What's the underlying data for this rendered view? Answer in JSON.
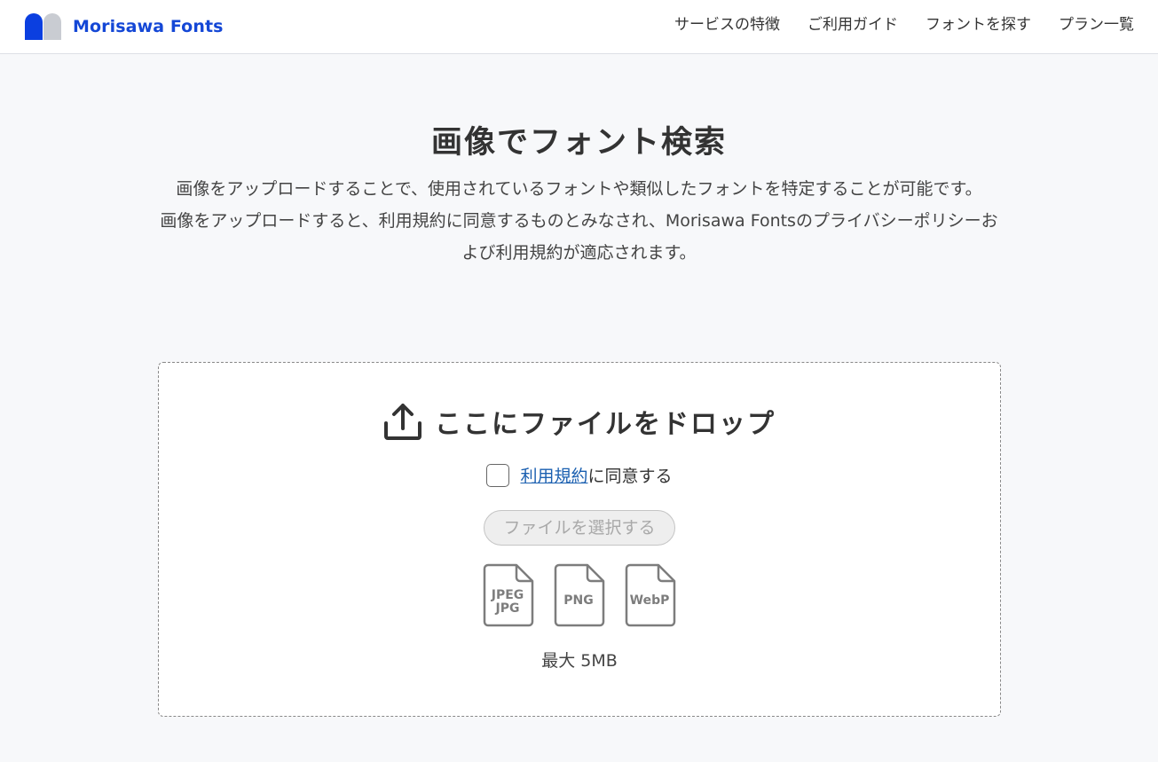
{
  "header": {
    "logo_text": "Morisawa Fonts",
    "brand_color": "#1447d6",
    "nav": [
      {
        "label": "サービスの特徴"
      },
      {
        "label": "ご利用ガイド"
      },
      {
        "label": "フォントを探す"
      },
      {
        "label": "プラン一覧"
      }
    ]
  },
  "main": {
    "title": "画像でフォント検索",
    "desc1": "画像をアップロードすることで、使用されているフォントや類似したフォントを特定することが可能です。",
    "desc2": "画像をアップロードすると、利用規約に同意するものとみなされ、Morisawa Fontsのプライバシーポリシーおよび利用規約が適応されます。"
  },
  "dropzone": {
    "title": "ここにファイルをドロップ",
    "agree_link": "利用規約",
    "agree_text": "に同意する",
    "agree_checked": false,
    "select_button": "ファイルを選択する",
    "formats": [
      {
        "line1": "JPEG",
        "line2": "JPG"
      },
      {
        "line1": "PNG"
      },
      {
        "line1": "WebP"
      }
    ],
    "max_size": "最大 5MB",
    "icons": [
      "upload-icon",
      "file-icon"
    ]
  }
}
